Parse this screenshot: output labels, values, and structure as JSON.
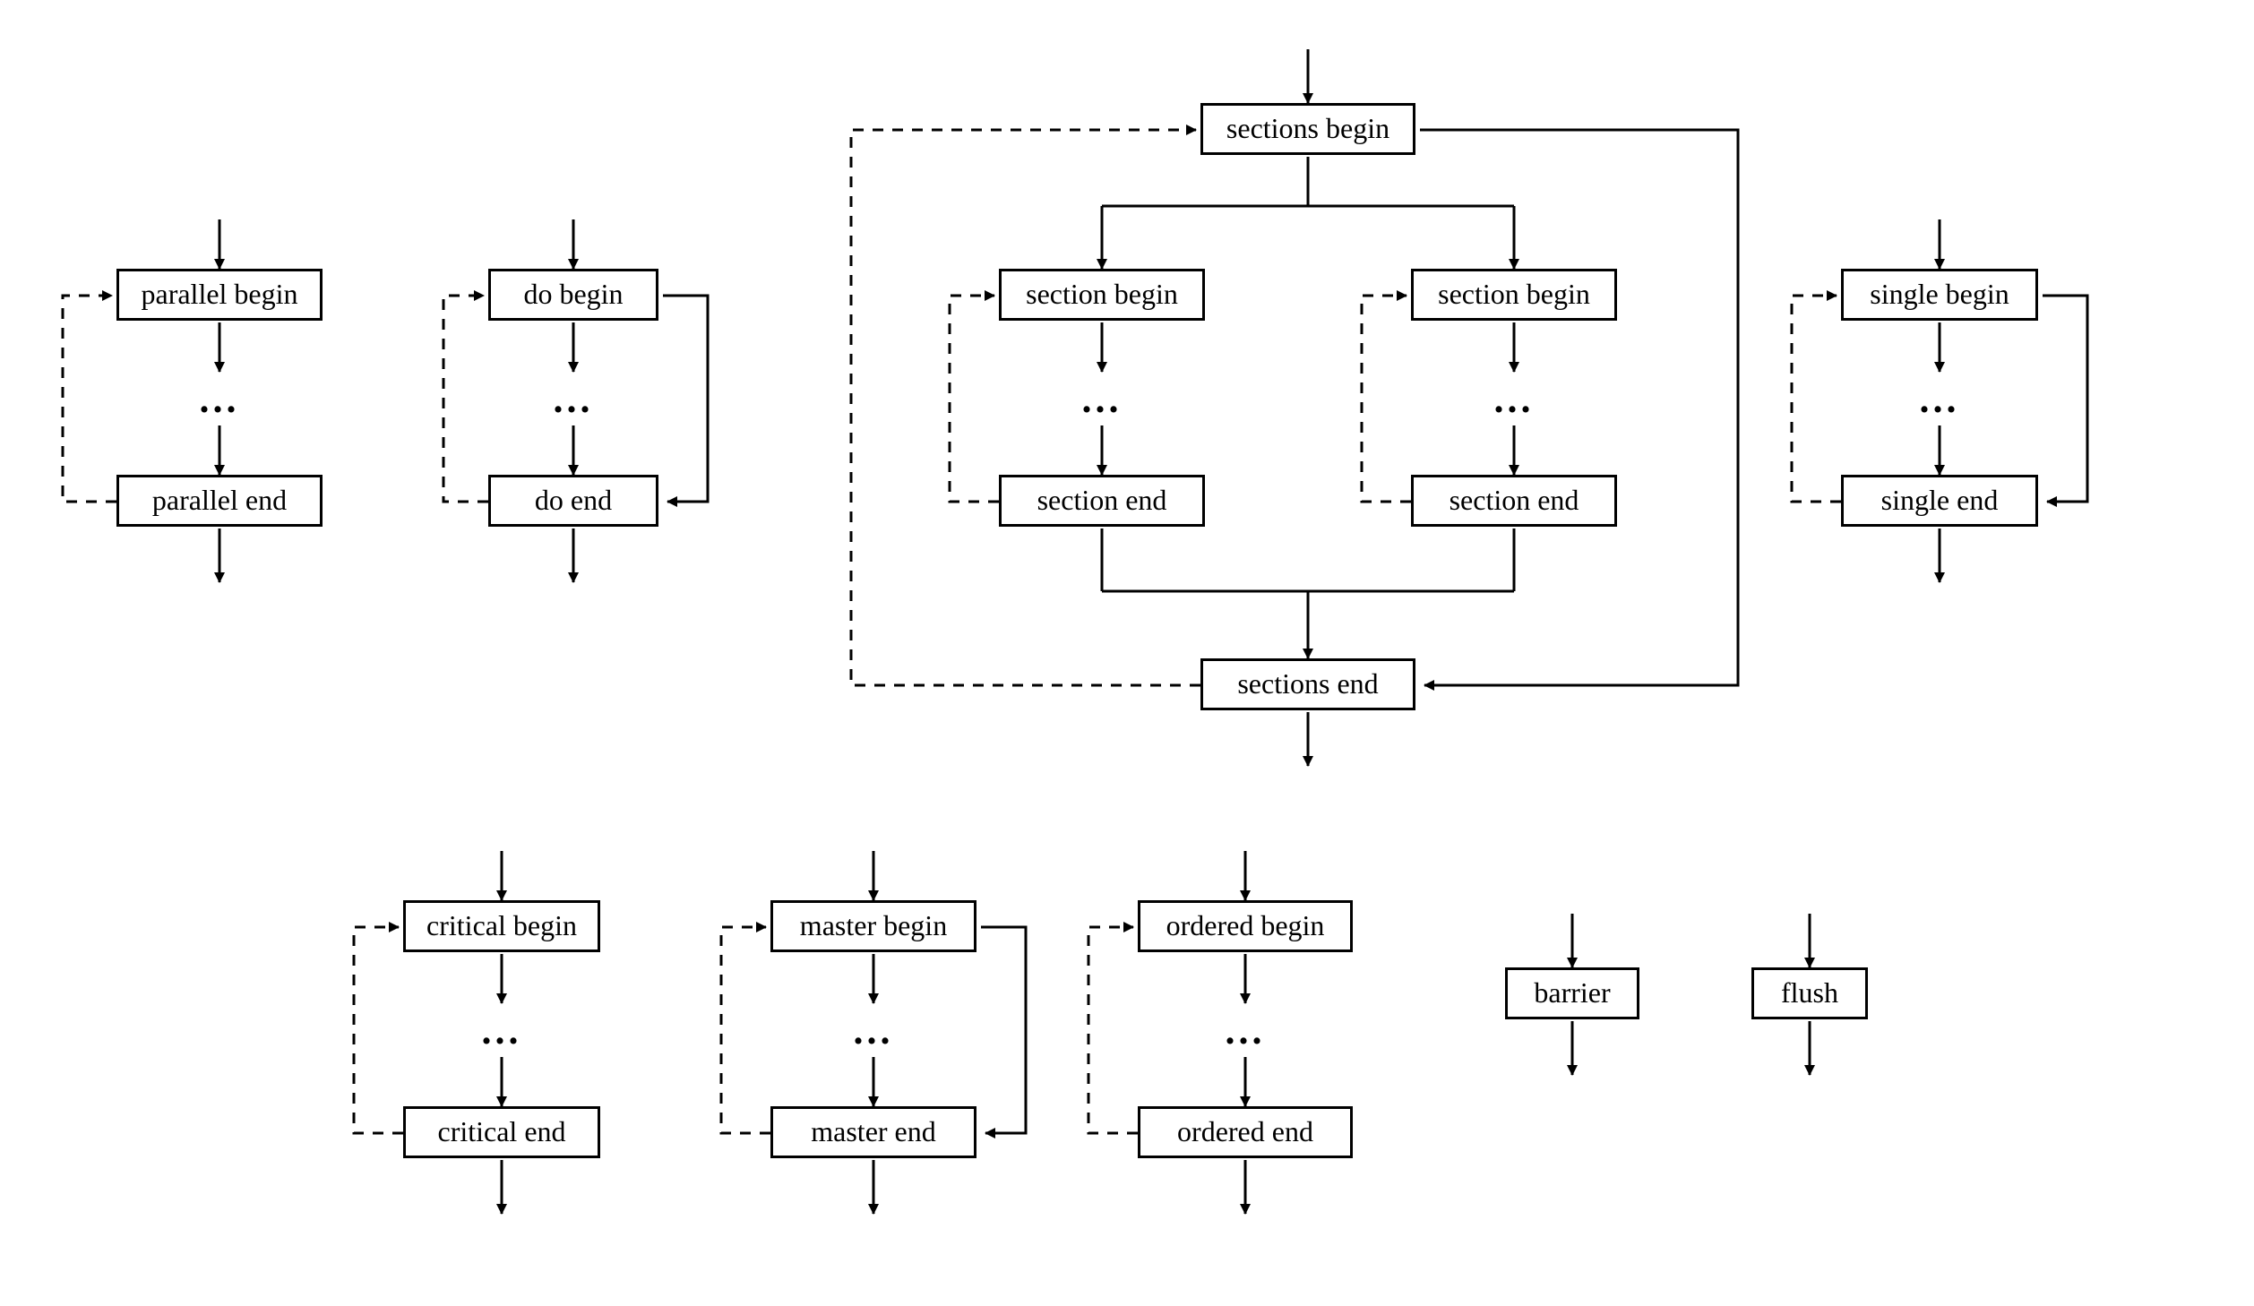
{
  "diagram": {
    "parallel": {
      "begin": "parallel begin",
      "end": "parallel end"
    },
    "do": {
      "begin": "do begin",
      "end": "do end"
    },
    "sections": {
      "begin": "sections begin",
      "end": "sections end"
    },
    "section_left": {
      "begin": "section begin",
      "end": "section end"
    },
    "section_right": {
      "begin": "section begin",
      "end": "section end"
    },
    "single": {
      "begin": "single begin",
      "end": "single end"
    },
    "critical": {
      "begin": "critical begin",
      "end": "critical end"
    },
    "master": {
      "begin": "master begin",
      "end": "master end"
    },
    "ordered": {
      "begin": "ordered begin",
      "end": "ordered end"
    },
    "barrier": "barrier",
    "flush": "flush",
    "ellipsis": "..."
  }
}
